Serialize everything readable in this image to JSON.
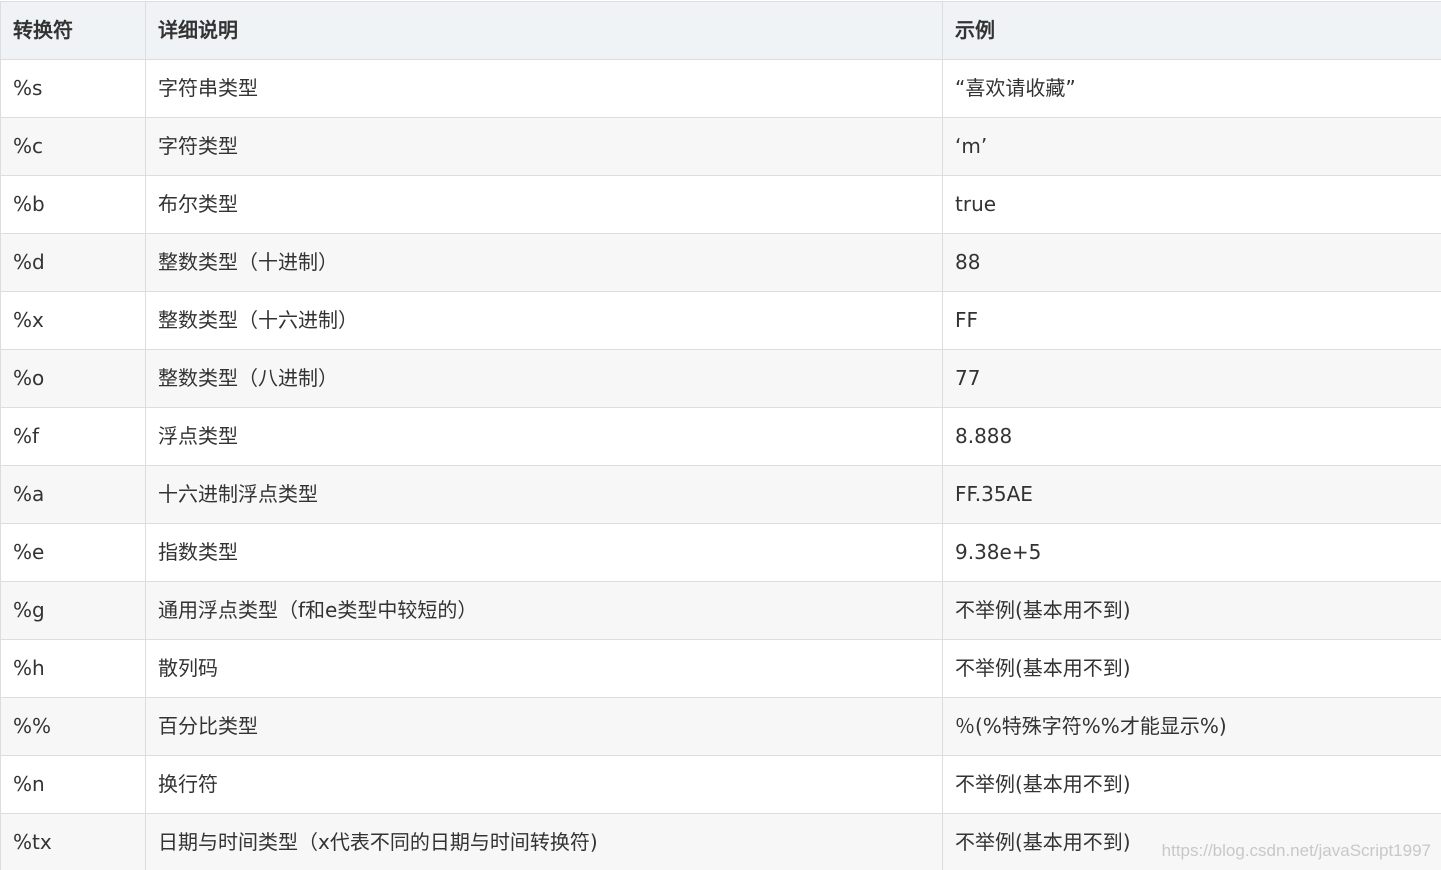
{
  "table": {
    "headers": [
      "转换符",
      "详细说明",
      "示例"
    ],
    "rows": [
      [
        "%s",
        "字符串类型",
        "“喜欢请收藏”"
      ],
      [
        "%c",
        "字符类型",
        "‘m’"
      ],
      [
        "%b",
        "布尔类型",
        "true"
      ],
      [
        "%d",
        "整数类型（十进制）",
        "88"
      ],
      [
        "%x",
        "整数类型（十六进制）",
        "FF"
      ],
      [
        "%o",
        "整数类型（八进制）",
        "77"
      ],
      [
        "%f",
        "浮点类型",
        "8.888"
      ],
      [
        "%a",
        "十六进制浮点类型",
        "FF.35AE"
      ],
      [
        "%e",
        "指数类型",
        "9.38e+5"
      ],
      [
        "%g",
        "通用浮点类型（f和e类型中较短的）",
        "不举例(基本用不到)"
      ],
      [
        "%h",
        "散列码",
        "不举例(基本用不到)"
      ],
      [
        "%%",
        "百分比类型",
        "％(%特殊字符%%才能显示%)"
      ],
      [
        "%n",
        "换行符",
        "不举例(基本用不到)"
      ],
      [
        "%tx",
        "日期与时间类型（x代表不同的日期与时间转换符)",
        "不举例(基本用不到)"
      ]
    ]
  },
  "watermark": "https://blog.csdn.net/javaScript1997"
}
